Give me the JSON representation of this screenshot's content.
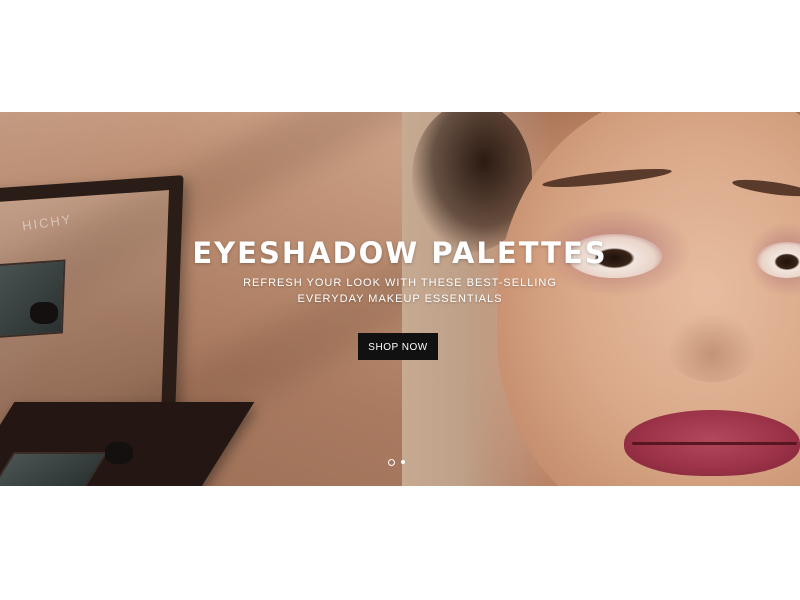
{
  "hero": {
    "headline": "EYESHADOW PALETTES",
    "subline_1": "REFRESH YOUR LOOK WITH THESE BEST-SELLING",
    "subline_2": "EVERYDAY MAKEUP ESSENTIALS",
    "cta_label": "SHOP NOW",
    "left_image": "eyeshadow-compact-image",
    "right_image": "model-face-image",
    "brand_engraving": "HICHY"
  },
  "carousel": {
    "slide_count": 2,
    "active_index": 0
  },
  "colors": {
    "background": "#ffffff",
    "button": "#111111",
    "text_on_image": "#ffffff"
  }
}
